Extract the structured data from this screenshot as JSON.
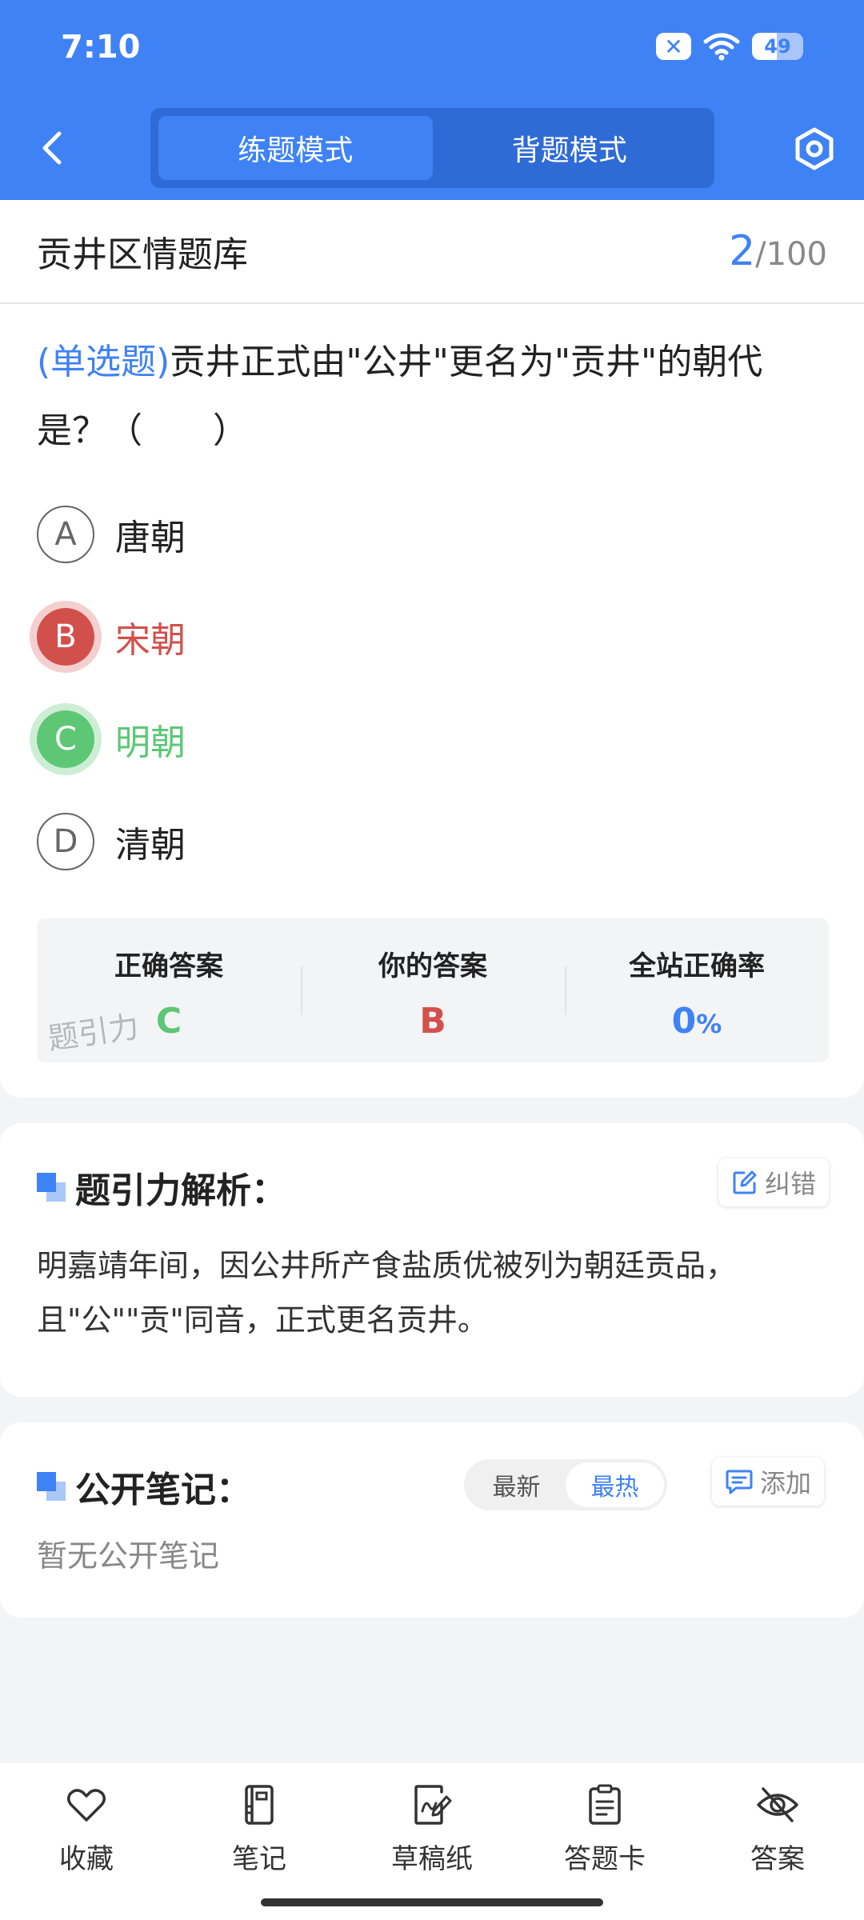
{
  "status_bar": {
    "time": "7:10",
    "battery": "49",
    "battery_level": 49
  },
  "header": {
    "tabs": [
      {
        "label": "练题模式",
        "active": true
      },
      {
        "label": "背题模式",
        "active": false
      }
    ]
  },
  "bank": {
    "title": "贡井区情题库",
    "current": "2",
    "total": "/100"
  },
  "question": {
    "type": "(单选题)",
    "text": "贡井正式由\"公井\"更名为\"贡井\"的朝代是？（　　）",
    "options": [
      {
        "letter": "A",
        "text": "唐朝",
        "state": "normal"
      },
      {
        "letter": "B",
        "text": "宋朝",
        "state": "wrong"
      },
      {
        "letter": "C",
        "text": "明朝",
        "state": "correct"
      },
      {
        "letter": "D",
        "text": "清朝",
        "state": "normal"
      }
    ]
  },
  "stats": {
    "correct_label": "正确答案",
    "correct_value": "C",
    "yours_label": "你的答案",
    "yours_value": "B",
    "rate_label": "全站正确率",
    "rate_value": "0",
    "rate_unit": "%",
    "watermark": "题引力"
  },
  "analysis": {
    "title": "题引力解析：",
    "report_label": "纠错",
    "text": "明嘉靖年间，因公井所产食盐质优被列为朝廷贡品，且\"公\"\"贡\"同音，正式更名贡井。"
  },
  "notes": {
    "title": "公开笔记：",
    "sort_options": [
      {
        "label": "最新",
        "active": false
      },
      {
        "label": "最热",
        "active": true
      }
    ],
    "add_label": "添加",
    "empty_text": "暂无公开笔记"
  },
  "bottom_nav": [
    {
      "label": "收藏",
      "icon": "heart-icon"
    },
    {
      "label": "笔记",
      "icon": "notebook-icon"
    },
    {
      "label": "草稿纸",
      "icon": "draft-icon"
    },
    {
      "label": "答题卡",
      "icon": "answer-sheet-icon"
    },
    {
      "label": "答案",
      "icon": "eye-off-icon"
    }
  ],
  "colors": {
    "brand": "#3f82f5",
    "wrong": "#d2504c",
    "correct": "#5dc776"
  }
}
